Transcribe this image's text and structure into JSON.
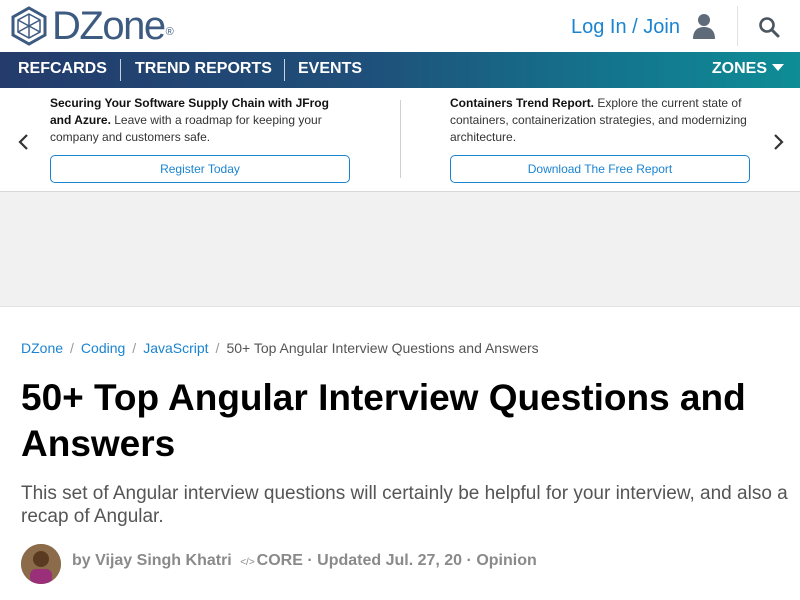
{
  "header": {
    "logo_text": "DZone",
    "logo_registered": "®",
    "login_label": "Log In / Join"
  },
  "nav": {
    "items": [
      "REFCARDS",
      "TREND REPORTS",
      "EVENTS"
    ],
    "zones_label": "ZONES"
  },
  "promo": {
    "left": {
      "bold": "Securing Your Software Supply Chain with JFrog and Azure.",
      "text": " Leave with a roadmap for keeping your company and customers safe.",
      "button": "Register Today"
    },
    "right": {
      "bold": "Containers Trend Report.",
      "text": " Explore the current state of containers, containerization strategies, and modernizing architecture.",
      "button": "Download The Free Report"
    }
  },
  "article": {
    "breadcrumb": [
      "DZone",
      "Coding",
      "JavaScript"
    ],
    "breadcrumb_sep": "/",
    "breadcrumb_current": "50+ Top Angular Interview Questions and Answers",
    "title": "50+ Top Angular Interview Questions and Answers",
    "subtitle": "This set of Angular interview questions will certainly be helpful for your interview, and also a recap of Angular.",
    "author_prefix": "by",
    "author": "Vijay Singh Khatri",
    "core_glyph": "</>",
    "core_label": "CORE",
    "dot1": "·",
    "updated": "Updated Jul. 27, 20",
    "dot2": "·",
    "category": "Opinion"
  },
  "colors": {
    "brand": "#3d5a80",
    "link": "#1b84d1",
    "nav_start": "#243b6b",
    "nav_end": "#0e8d96"
  },
  "icons": [
    "dzone-logo-icon",
    "user-icon",
    "search-icon",
    "chevron-left-icon",
    "chevron-right-icon",
    "code-icon"
  ]
}
